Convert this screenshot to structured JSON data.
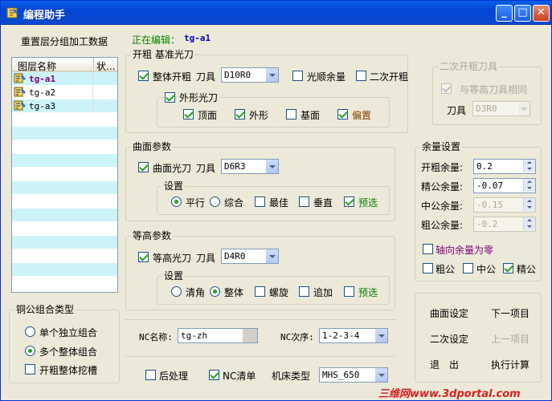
{
  "window": {
    "title": "编程助手"
  },
  "left": {
    "section_label": "重置层分组加工数据",
    "columns": [
      "图层名称",
      "状..."
    ],
    "rows": [
      {
        "name": "tg-a1",
        "selected": true
      },
      {
        "name": "tg-a2"
      },
      {
        "name": "tg-a3"
      }
    ],
    "group_type": {
      "legend": "铜公组合类型",
      "options": [
        "单个独立组合",
        "多个整体组合"
      ],
      "selected": "多个整体组合",
      "pit": "开粗整体挖槽"
    }
  },
  "editing": {
    "label": "正在编辑：",
    "value": "tg-a1"
  },
  "rough": {
    "legend": "开粗 基准光刀",
    "whole_rough": "整体开粗",
    "tool_label": "刀具",
    "tool": "D10R0",
    "smooth_allow": "光顺余量",
    "second_rough": "二次开粗",
    "outer": {
      "legend": "外形光刀",
      "top": "顶面",
      "shape": "外形",
      "base": "基面",
      "offset": "偏置"
    }
  },
  "second_rough_tool": {
    "legend": "二次开粗刀具",
    "same": "与等高刀具相同",
    "tool_label": "刀具",
    "tool": "D3R0"
  },
  "surface": {
    "legend": "曲面参数",
    "enable": "曲面光刀",
    "tool_label": "刀具",
    "tool": "D6R3",
    "settings": "设置",
    "options": [
      "平行",
      "综合"
    ],
    "selected": "平行",
    "best": "最佳",
    "vertical": "垂直",
    "preselect": "预选"
  },
  "contour": {
    "legend": "等高参数",
    "enable": "等高光刀",
    "tool_label": "刀具",
    "tool": "D4R0",
    "settings": "设置",
    "options": [
      "清角",
      "整体"
    ],
    "selected": "整体",
    "spiral": "螺旋",
    "append": "追加",
    "preselect": "预选"
  },
  "allowance": {
    "legend": "余量设置",
    "fields": [
      {
        "label": "开粗余量:",
        "value": "0.2",
        "enabled": true
      },
      {
        "label": "精公余量:",
        "value": "-0.07",
        "enabled": true
      },
      {
        "label": "中公余量:",
        "value": "-0.15",
        "enabled": false
      },
      {
        "label": "粗公余量:",
        "value": "-0.2",
        "enabled": false
      }
    ],
    "axial_zero": "轴向余量为零",
    "rough": "粗公",
    "mid": "中公",
    "fine": "精公"
  },
  "nc": {
    "name_label": "NC名称:",
    "name": "tg-zh",
    "order_label": "NC次序:",
    "order": "1-2-3-4"
  },
  "bottom": {
    "post": "后处理",
    "nc_list": "NC清单",
    "machine_label": "机床类型",
    "machine": "MHS_650"
  },
  "actions": {
    "surface_set": "曲面设定",
    "next": "下一项目",
    "second_set": "二次设定",
    "prev": "上一项目",
    "exit": "退　出",
    "run": "执行计算"
  },
  "watermark": "三维网www.3dportal.com"
}
